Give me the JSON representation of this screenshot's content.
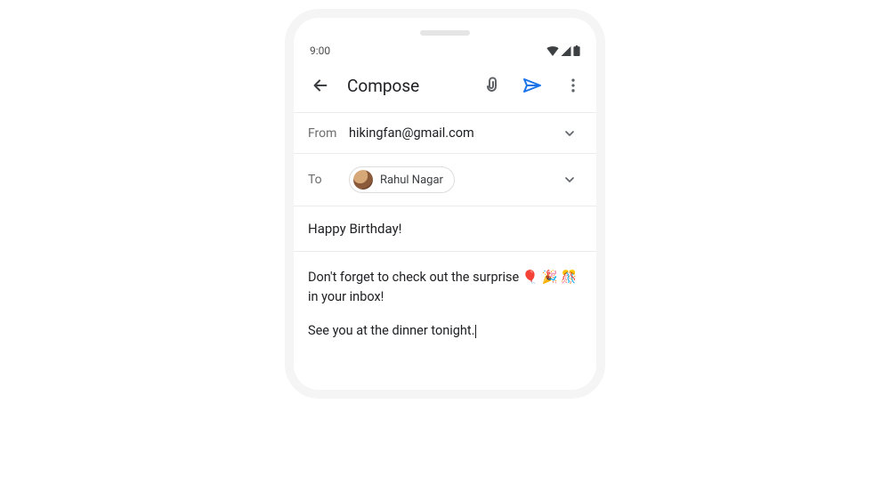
{
  "status": {
    "time": "9:00"
  },
  "appbar": {
    "title": "Compose"
  },
  "from": {
    "label": "From",
    "value": "hikingfan@gmail.com"
  },
  "to": {
    "label": "To",
    "chip_name": "Rahul Nagar"
  },
  "subject": "Happy Birthday!",
  "body": {
    "line1_a": "Don't forget to check out the surprise",
    "line1_b": "in your inbox!",
    "line2": "See you at the dinner tonight.",
    "emoji_balloon": "🎈",
    "emoji_party": "🎉",
    "emoji_confetti": "🎊"
  }
}
